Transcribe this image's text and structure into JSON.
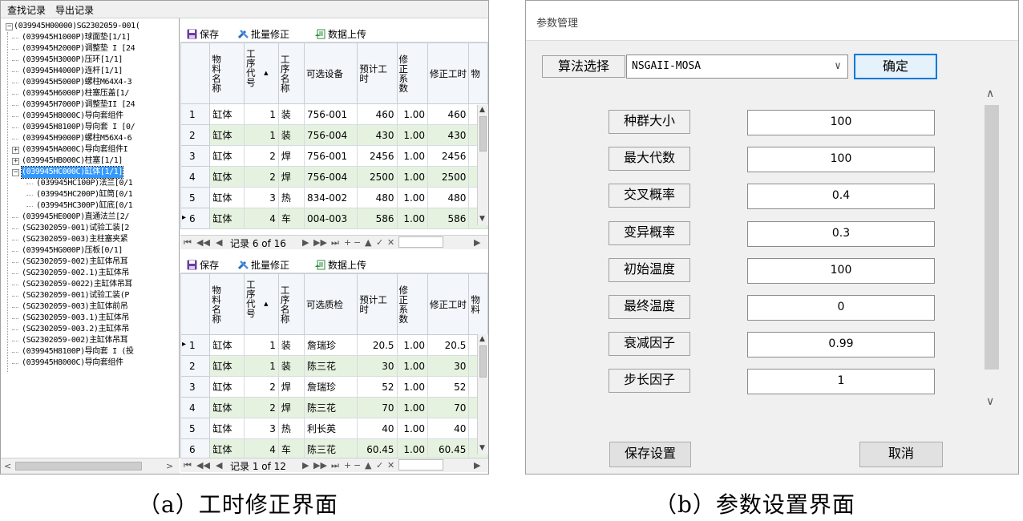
{
  "panel_a": {
    "menu": [
      "查找记录",
      "导出记录"
    ],
    "tree": [
      {
        "text": "(039945H00000)SG2302059-001(",
        "indent": 0,
        "expander": "−"
      },
      {
        "text": "(039945H1000P)球面垫[1/1]",
        "indent": 1
      },
      {
        "text": "(039945H2000P)调整垫 I [24",
        "indent": 1
      },
      {
        "text": "(039945H3000P)压环[1/1]",
        "indent": 1
      },
      {
        "text": "(039945H4000P)连杆[1/1]",
        "indent": 1
      },
      {
        "text": "(039945H5000P)螺柱M64X4-3",
        "indent": 1
      },
      {
        "text": "(039945H6000P)柱塞压盖[1/",
        "indent": 1
      },
      {
        "text": "(039945H7000P)调整垫II [24",
        "indent": 1
      },
      {
        "text": "(039945H8000C)导向套组件",
        "indent": 1
      },
      {
        "text": "(039945H8100P)导向套 I [0/",
        "indent": 1
      },
      {
        "text": "(039945H9000P)螺柱M56X4-6",
        "indent": 1
      },
      {
        "text": "(039945HA000C)导向套组件I",
        "indent": 1,
        "expander": "+"
      },
      {
        "text": "(039945HB000C)柱塞[1/1]",
        "indent": 1,
        "expander": "+"
      },
      {
        "text": "(039945HC000C)缸体[1/1]",
        "indent": 1,
        "expander": "−",
        "selected": true
      },
      {
        "text": "(039945HC100P)法兰[0/1",
        "indent": 2
      },
      {
        "text": "(039945HC200P)缸筒[0/1",
        "indent": 2
      },
      {
        "text": "(039945HC300P)缸底[0/1",
        "indent": 2
      },
      {
        "text": "(039945HE000P)直通法兰[2/",
        "indent": 1
      },
      {
        "text": "(SG2302059-001)试验工装[2",
        "indent": 1
      },
      {
        "text": "(SG2302059-003)主柱塞夹紧",
        "indent": 1
      },
      {
        "text": "(039945HG000P)压板[0/1]",
        "indent": 1
      },
      {
        "text": "(SG2302059-002)主缸体吊耳",
        "indent": 1
      },
      {
        "text": "(SG2302059-002.1)主缸体吊",
        "indent": 1
      },
      {
        "text": "(SG2302059-0022)主缸体吊耳",
        "indent": 1
      },
      {
        "text": "(SG2302059-001)试验工装(P",
        "indent": 1
      },
      {
        "text": "(SG2302059-003)主缸体前吊",
        "indent": 1
      },
      {
        "text": "(SG2302059-003.1)主缸体吊",
        "indent": 1
      },
      {
        "text": "(SG2302059-003.2)主缸体吊",
        "indent": 1
      },
      {
        "text": "(SG2302059-002)主缸体吊耳",
        "indent": 1
      },
      {
        "text": "(039945H8100P)导向套 I (投",
        "indent": 1
      },
      {
        "text": "(039945H8000C)导向套组件",
        "indent": 1
      }
    ],
    "toolbar": {
      "save": "保存",
      "batch": "批量修正",
      "upload": "数据上传"
    },
    "grid1": {
      "headers": [
        "物料名称",
        "工序代号",
        "工序名称",
        "可选设备",
        "预计工时",
        "修正系数",
        "修正工时",
        "物"
      ],
      "rows": [
        {
          "no": "1",
          "material": "缸体",
          "seq": "1",
          "op": "装",
          "option": "756-001",
          "est": "460",
          "coef": "1.00",
          "fixed": "460"
        },
        {
          "no": "2",
          "material": "缸体",
          "seq": "1",
          "op": "装",
          "option": "756-004",
          "est": "430",
          "coef": "1.00",
          "fixed": "430"
        },
        {
          "no": "3",
          "material": "缸体",
          "seq": "2",
          "op": "焊",
          "option": "756-001",
          "est": "2456",
          "coef": "1.00",
          "fixed": "2456"
        },
        {
          "no": "4",
          "material": "缸体",
          "seq": "2",
          "op": "焊",
          "option": "756-004",
          "est": "2500",
          "coef": "1.00",
          "fixed": "2500"
        },
        {
          "no": "5",
          "material": "缸体",
          "seq": "3",
          "op": "热",
          "option": "834-002",
          "est": "480",
          "coef": "1.00",
          "fixed": "480"
        },
        {
          "no": "6",
          "material": "缸体",
          "seq": "4",
          "op": "车",
          "option": "004-003",
          "est": "586",
          "coef": "1.00",
          "fixed": "586",
          "current": true
        }
      ],
      "record": "记录 6 of 16"
    },
    "grid2": {
      "headers": [
        "物料名称",
        "工序代号",
        "工序名称",
        "可选质检",
        "预计工时",
        "修正系数",
        "修正工时",
        "物料"
      ],
      "rows": [
        {
          "no": "1",
          "material": "缸体",
          "seq": "1",
          "op": "装",
          "option": "詹瑞珍",
          "est": "20.5",
          "coef": "1.00",
          "fixed": "20.5",
          "current": true
        },
        {
          "no": "2",
          "material": "缸体",
          "seq": "1",
          "op": "装",
          "option": "陈三花",
          "est": "30",
          "coef": "1.00",
          "fixed": "30"
        },
        {
          "no": "3",
          "material": "缸体",
          "seq": "2",
          "op": "焊",
          "option": "詹瑞珍",
          "est": "52",
          "coef": "1.00",
          "fixed": "52"
        },
        {
          "no": "4",
          "material": "缸体",
          "seq": "2",
          "op": "焊",
          "option": "陈三花",
          "est": "70",
          "coef": "1.00",
          "fixed": "70"
        },
        {
          "no": "5",
          "material": "缸体",
          "seq": "3",
          "op": "热",
          "option": "利长英",
          "est": "40",
          "coef": "1.00",
          "fixed": "40"
        },
        {
          "no": "6",
          "material": "缸体",
          "seq": "4",
          "op": "车",
          "option": "陈三花",
          "est": "60.45",
          "coef": "1.00",
          "fixed": "60.45"
        }
      ],
      "record": "记录 1 of 12"
    }
  },
  "panel_b": {
    "title": "参数管理",
    "algo_label": "算法选择",
    "algo_value": "NSGAII-MOSA",
    "confirm": "确定",
    "params": [
      {
        "label": "种群大小",
        "value": "100"
      },
      {
        "label": "最大代数",
        "value": "100"
      },
      {
        "label": "交叉概率",
        "value": "0.4"
      },
      {
        "label": "变异概率",
        "value": "0.3"
      },
      {
        "label": "初始温度",
        "value": "100"
      },
      {
        "label": "最终温度",
        "value": "0"
      },
      {
        "label": "衰减因子",
        "value": "0.99"
      },
      {
        "label": "步长因子",
        "value": "1"
      }
    ],
    "save": "保存设置",
    "cancel": "取消"
  },
  "captions": {
    "a": "（a）工时修正界面",
    "b": "（b）参数设置界面"
  },
  "colors": {
    "selection": "#3399ff",
    "alt_row": "#e6f2e0",
    "accent_border": "#0078d7"
  }
}
